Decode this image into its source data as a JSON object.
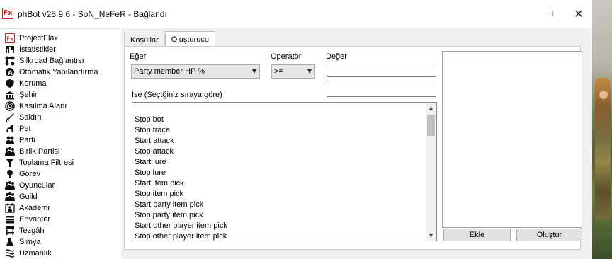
{
  "window": {
    "title": "phBot v25.9.6 - SoN_NeFeR - Bağlandı",
    "app_icon_glyph": "Fx",
    "maximize_glyph": "☐",
    "close_glyph": "✕"
  },
  "sidebar": {
    "items": [
      {
        "label": "ProjectFlax",
        "icon": "fx-icon"
      },
      {
        "label": "İstatistikler",
        "icon": "stats-icon"
      },
      {
        "label": "Silkroad Bağlantısı",
        "icon": "network-icon"
      },
      {
        "label": "Otomatik Yapılandırma",
        "icon": "auto-config-icon"
      },
      {
        "label": "Koruma",
        "icon": "shield-icon"
      },
      {
        "label": "Şehir",
        "icon": "city-icon"
      },
      {
        "label": "Kasılma Alanı",
        "icon": "training-area-icon"
      },
      {
        "label": "Saldırı",
        "icon": "sword-icon"
      },
      {
        "label": "Pet",
        "icon": "pet-icon"
      },
      {
        "label": "Parti",
        "icon": "party-icon"
      },
      {
        "label": "Birlik Partisi",
        "icon": "union-party-icon"
      },
      {
        "label": "Toplama Filtresi",
        "icon": "filter-icon"
      },
      {
        "label": "Görev",
        "icon": "quest-icon"
      },
      {
        "label": "Oyuncular",
        "icon": "players-icon"
      },
      {
        "label": "Guild",
        "icon": "guild-icon"
      },
      {
        "label": "Akademi",
        "icon": "academy-icon"
      },
      {
        "label": "Envanter",
        "icon": "inventory-icon"
      },
      {
        "label": "Tezgâh",
        "icon": "stall-icon"
      },
      {
        "label": "Simya",
        "icon": "alchemy-icon"
      },
      {
        "label": "Uzmanlık",
        "icon": "expertise-icon"
      }
    ]
  },
  "tabs": [
    {
      "label": "Koşullar",
      "active": false
    },
    {
      "label": "Oluşturucu",
      "active": true
    }
  ],
  "builder": {
    "if_label": "Eğer",
    "if_value": "Party member HP %",
    "operator_label": "Operatör",
    "operator_value": ">=",
    "value_label": "Değer",
    "value_input": "",
    "value_input2": "",
    "then_label": "İse (Seçtğiniz sıraya göre)",
    "actions": [
      "",
      "Stop bot",
      "Stop trace",
      "Start attack",
      "Stop attack",
      "Start lure",
      "Stop lure",
      "Start item pick",
      "Stop item pick",
      "Start party item pick",
      "Stop party item pick",
      "Start other player item pick",
      "Stop other player item pick"
    ],
    "add_button": "Ekle",
    "create_button": "Oluştur"
  }
}
